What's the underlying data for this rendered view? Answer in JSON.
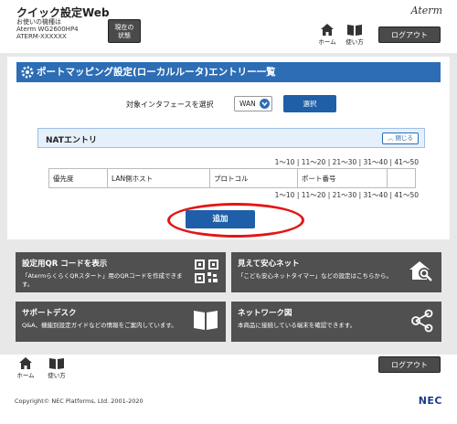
{
  "header": {
    "title": "クイック設定Web",
    "model_label": "お使いの機種は",
    "model_name": "Aterm WG2600HP4",
    "device_id": "ATERM-XXXXXX",
    "status_button": [
      "現在の",
      "状態"
    ],
    "brand": "Aterm",
    "home_label": "ホーム",
    "help_label": "使い方",
    "logout_label": "ログアウト"
  },
  "page": {
    "heading": "ポートマッピング設定(ローカルルータ)エントリー一覧",
    "interface_label": "対象インタフェースを選択",
    "interface_value": "WAN",
    "select_button": "選択"
  },
  "nat": {
    "title": "NATエントリ",
    "close_label": "閉じる",
    "pager": [
      "1～10",
      "11～20",
      "21～30",
      "31～40",
      "41～50"
    ],
    "columns": [
      "優先度",
      "LAN側ホスト",
      "プロトコル",
      "ポート番号",
      ""
    ]
  },
  "add_button": "追加",
  "tiles": [
    {
      "title": "設定用QR コードを表示",
      "desc": "「AtermらくらくQRスタート」用のQRコードを作成できます。",
      "icon": "qr-code-icon"
    },
    {
      "title": "見えて安心ネット",
      "desc": "「こども安心ネットタイマー」などの設定はこちらから。",
      "icon": "home-search-icon"
    },
    {
      "title": "サポートデスク",
      "desc": "Q&A、機能別設定ガイドなどの情報をご案内しています。",
      "icon": "book-icon"
    },
    {
      "title": "ネットワーク図",
      "desc": "本商品に接続している端末を確認できます。",
      "icon": "network-icon"
    }
  ],
  "footer": {
    "home_label": "ホーム",
    "help_label": "使い方",
    "logout_label": "ログアウト",
    "copyright": "Copyright© NEC Platforms, Ltd. 2001-2020",
    "nec_logo": "NEC"
  },
  "colors": {
    "accent": "#2d6db5",
    "highlight": "#e41515",
    "tile": "#505050"
  }
}
